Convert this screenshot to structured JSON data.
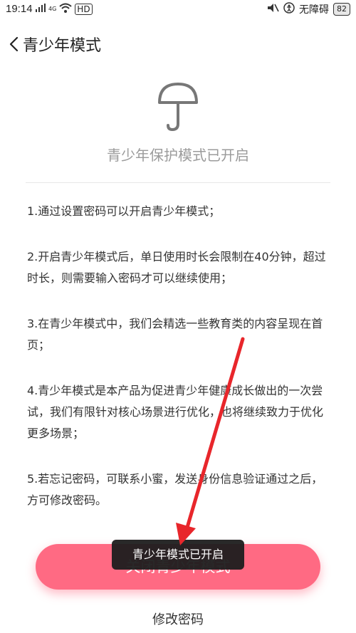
{
  "status_bar": {
    "time": "19:14",
    "network_label": "4G",
    "hd_label": "HD",
    "accessibility": "无障碍",
    "battery": "82"
  },
  "header": {
    "title": "青少年模式"
  },
  "hero": {
    "icon": "umbrella-icon",
    "status": "青少年保护模式已开启"
  },
  "rules": [
    "1.通过设置密码可以开启青少年模式；",
    "2.开启青少年模式后，单日使用时长会限制在40分钟，超过时长，则需要输入密码才可以继续使用；",
    "3.在青少年模式中，我们会精选一些教育类的内容呈现在首页；",
    "4.青少年模式是本产品为促进青少年健康成长做出的一次尝试，我们有限针对核心场景进行优化，也将继续致力于优化更多场景；",
    "5.若忘记密码，可联系小蜜，发送身份信息验证通过之后，方可修改密码。"
  ],
  "actions": {
    "primary": "关闭青少年模式",
    "secondary": "修改密码"
  },
  "toast": "青少年模式已开启",
  "colors": {
    "accent": "#ff6a83",
    "arrow": "#e8262b"
  }
}
